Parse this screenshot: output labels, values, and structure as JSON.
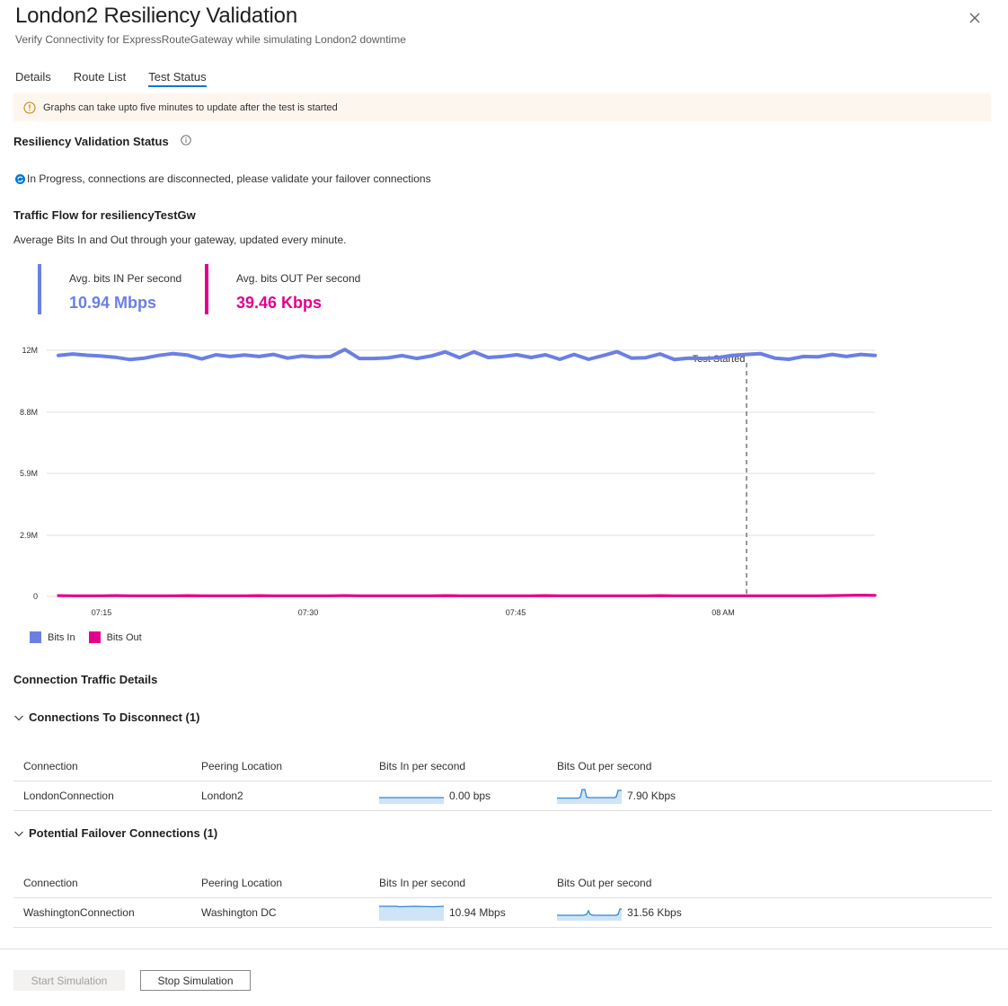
{
  "panel": {
    "title": "London2 Resiliency Validation",
    "subtitle": "Verify Connectivity for ExpressRouteGateway while simulating London2 downtime"
  },
  "tabs": [
    {
      "label": "Details",
      "active": false
    },
    {
      "label": "Route List",
      "active": false
    },
    {
      "label": "Test Status",
      "active": true
    }
  ],
  "banner": {
    "text": "Graphs can take upto five minutes to update after the test is started",
    "icon": "warning-circle-icon"
  },
  "status": {
    "heading": "Resiliency Validation Status",
    "message": "In Progress, connections are disconnected, please validate your failover connections"
  },
  "traffic": {
    "heading": "Traffic Flow for resiliencyTestGw",
    "description": "Average Bits In and Out through your gateway, updated every minute.",
    "metrics": [
      {
        "label": "Avg. bits IN Per second",
        "value": "10.94 Mbps",
        "color": "#6b7fe3"
      },
      {
        "label": "Avg. bits OUT Per second",
        "value": "39.46 Kbps",
        "color": "#e3008c"
      }
    ]
  },
  "chart_data": {
    "type": "line",
    "y_ticks": [
      "12M",
      "8.8M",
      "5.9M",
      "2.9M",
      "0"
    ],
    "x_ticks": [
      "07:15",
      "07:30",
      "07:45",
      "08 AM"
    ],
    "annotation": "Test Started",
    "series": [
      {
        "name": "Bits In",
        "color": "#6b7fe3",
        "values": [
          11.75,
          11.82,
          11.76,
          11.72,
          11.66,
          11.55,
          11.62,
          11.75,
          11.84,
          11.77,
          11.58,
          11.78,
          11.7,
          11.77,
          11.7,
          11.8,
          11.62,
          11.72,
          11.67,
          11.7,
          12.04,
          11.6,
          11.6,
          11.63,
          11.74,
          11.6,
          11.72,
          11.92,
          11.64,
          11.92,
          11.65,
          11.7,
          11.78,
          11.65,
          11.78,
          11.56,
          11.8,
          11.56,
          11.74,
          11.93,
          11.62,
          11.64,
          11.82,
          11.55,
          11.62,
          11.6,
          11.63,
          11.75,
          11.8,
          11.84,
          11.62,
          11.56,
          11.7,
          11.68,
          11.8,
          11.7,
          11.8,
          11.75
        ]
      },
      {
        "name": "Bits Out",
        "color": "#e3008c",
        "values": [
          0.04,
          0.03,
          0.03,
          0.03,
          0.04,
          0.03,
          0.03,
          0.03,
          0.03,
          0.04,
          0.03,
          0.03,
          0.03,
          0.03,
          0.04,
          0.03,
          0.03,
          0.03,
          0.03,
          0.03,
          0.04,
          0.03,
          0.03,
          0.03,
          0.03,
          0.03,
          0.03,
          0.04,
          0.03,
          0.03,
          0.03,
          0.03,
          0.03,
          0.03,
          0.04,
          0.03,
          0.03,
          0.03,
          0.03,
          0.03,
          0.03,
          0.03,
          0.04,
          0.03,
          0.03,
          0.03,
          0.03,
          0.03,
          0.03,
          0.03,
          0.03,
          0.03,
          0.03,
          0.03,
          0.04,
          0.05,
          0.06,
          0.05
        ]
      }
    ],
    "x_range": [
      "07:07",
      "08:05"
    ],
    "ylim": [
      0,
      12
    ],
    "grid": true,
    "legend_position": "bottom-left"
  },
  "connection_details": {
    "heading": "Connection Traffic Details",
    "columns": [
      "Connection",
      "Peering Location",
      "Bits In per second",
      "Bits Out per second"
    ],
    "sections": [
      {
        "title": "Connections To Disconnect (1)",
        "rows": [
          {
            "connection": "LondonConnection",
            "location": "London2",
            "bits_in": "0.00 bps",
            "bits_out": "7.90 Kbps"
          }
        ]
      },
      {
        "title": "Potential Failover Connections (1)",
        "rows": [
          {
            "connection": "WashingtonConnection",
            "location": "Washington DC",
            "bits_in": "10.94 Mbps",
            "bits_out": "31.56 Kbps"
          }
        ]
      }
    ]
  },
  "footer": {
    "start_label": "Start Simulation",
    "stop_label": "Stop Simulation"
  }
}
